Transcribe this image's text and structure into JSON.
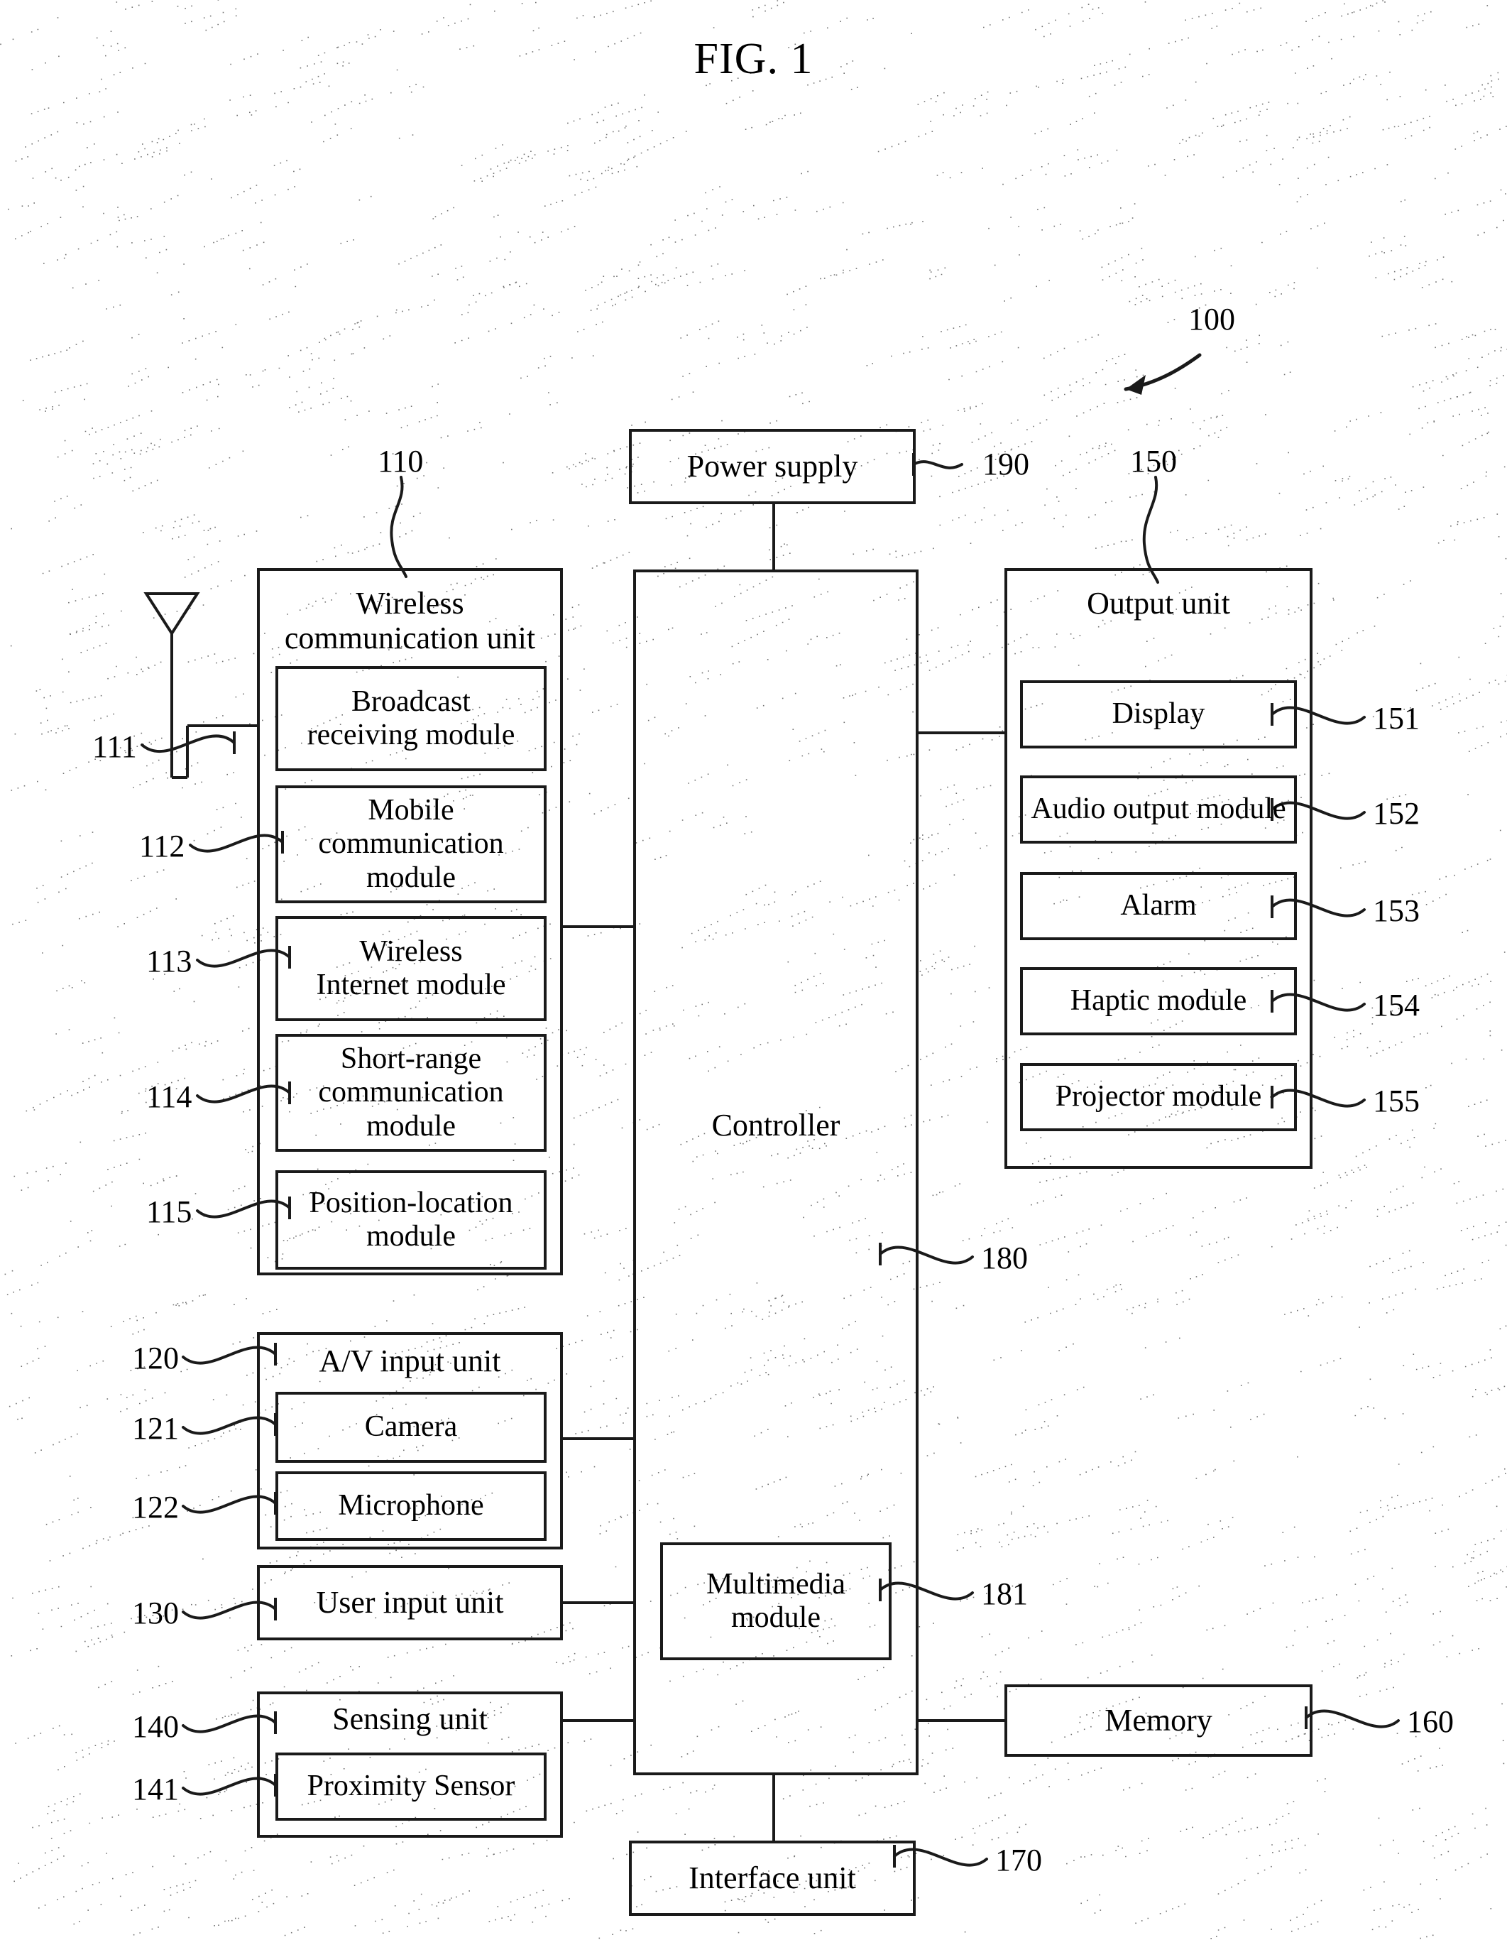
{
  "figure": {
    "title": "FIG. 1",
    "device_ref": "100"
  },
  "blocks": {
    "power_supply": {
      "label": "Power supply",
      "ref": "190"
    },
    "wireless_unit": {
      "label": "Wireless\ncommunication unit",
      "ref": "110"
    },
    "broadcast": {
      "label": "Broadcast\nreceiving module",
      "ref": "111"
    },
    "mobile_comm": {
      "label": "Mobile\ncommunication\nmodule",
      "ref": "112"
    },
    "wireless_internet": {
      "label": "Wireless\nInternet module",
      "ref": "113"
    },
    "short_range": {
      "label": "Short-range\ncommunication\nmodule",
      "ref": "114"
    },
    "position_location": {
      "label": "Position-location\nmodule",
      "ref": "115"
    },
    "av_input_unit": {
      "label": "A/V input unit",
      "ref": "120"
    },
    "camera": {
      "label": "Camera",
      "ref": "121"
    },
    "microphone": {
      "label": "Microphone",
      "ref": "122"
    },
    "user_input_unit": {
      "label": "User input unit",
      "ref": "130"
    },
    "sensing_unit": {
      "label": "Sensing unit",
      "ref": "140"
    },
    "proximity_sensor": {
      "label": "Proximity Sensor",
      "ref": "141"
    },
    "controller": {
      "label": "Controller",
      "ref": "180"
    },
    "multimedia_module": {
      "label": "Multimedia\nmodule",
      "ref": "181"
    },
    "output_unit": {
      "label": "Output unit",
      "ref": "150"
    },
    "display": {
      "label": "Display",
      "ref": "151"
    },
    "audio_output": {
      "label": "Audio output module",
      "ref": "152"
    },
    "alarm": {
      "label": "Alarm",
      "ref": "153"
    },
    "haptic_module": {
      "label": "Haptic module",
      "ref": "154"
    },
    "projector_module": {
      "label": "Projector module",
      "ref": "155"
    },
    "memory": {
      "label": "Memory",
      "ref": "160"
    },
    "interface_unit": {
      "label": "Interface unit",
      "ref": "170"
    }
  },
  "icons": {
    "antenna": "antenna-icon"
  },
  "colors": {
    "ink": "#1a1a1a",
    "paper": "#ffffff"
  }
}
